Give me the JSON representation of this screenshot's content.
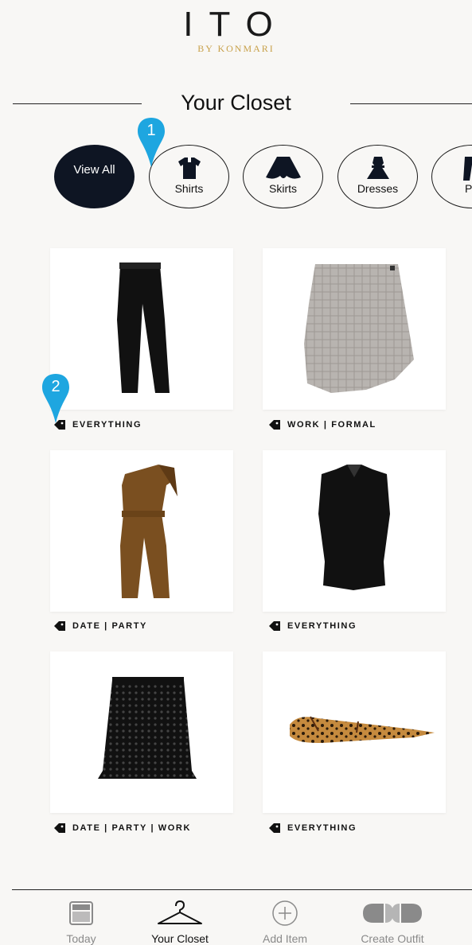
{
  "header": {
    "logo": "ITO",
    "logo_sub": "BY KONMARI"
  },
  "section_title": "Your Closet",
  "categories": [
    {
      "label": "View All",
      "active": true
    },
    {
      "label": "Shirts",
      "icon": "shirt-icon"
    },
    {
      "label": "Skirts",
      "icon": "skirt-icon"
    },
    {
      "label": "Dresses",
      "icon": "dress-icon"
    },
    {
      "label": "Pa",
      "icon": "pants-icon"
    }
  ],
  "markers": [
    "1",
    "2"
  ],
  "items": [
    {
      "tag": "EVERYTHING",
      "image": "black-trousers"
    },
    {
      "tag": "WORK | FORMAL",
      "image": "plaid-wrap-skirt"
    },
    {
      "tag": "DATE | PARTY",
      "image": "brown-one-shoulder-jumpsuit"
    },
    {
      "tag": "EVERYTHING",
      "image": "black-sleeveless-shirt"
    },
    {
      "tag": "DATE | PARTY | WORK",
      "image": "black-lace-skirt"
    },
    {
      "tag": "EVERYTHING",
      "image": "leopard-flats"
    }
  ],
  "nav": [
    {
      "label": "Today",
      "icon": "calendar-icon"
    },
    {
      "label": "Your Closet",
      "icon": "hanger-icon",
      "active": true
    },
    {
      "label": "Add Item",
      "icon": "add-circle-icon"
    },
    {
      "label": "Create Outfit",
      "icon": "outfit-icon"
    }
  ],
  "colors": {
    "accent_gold": "#c8a14a",
    "active_pill": "#0e1523",
    "marker_blue": "#1ea6e0"
  }
}
